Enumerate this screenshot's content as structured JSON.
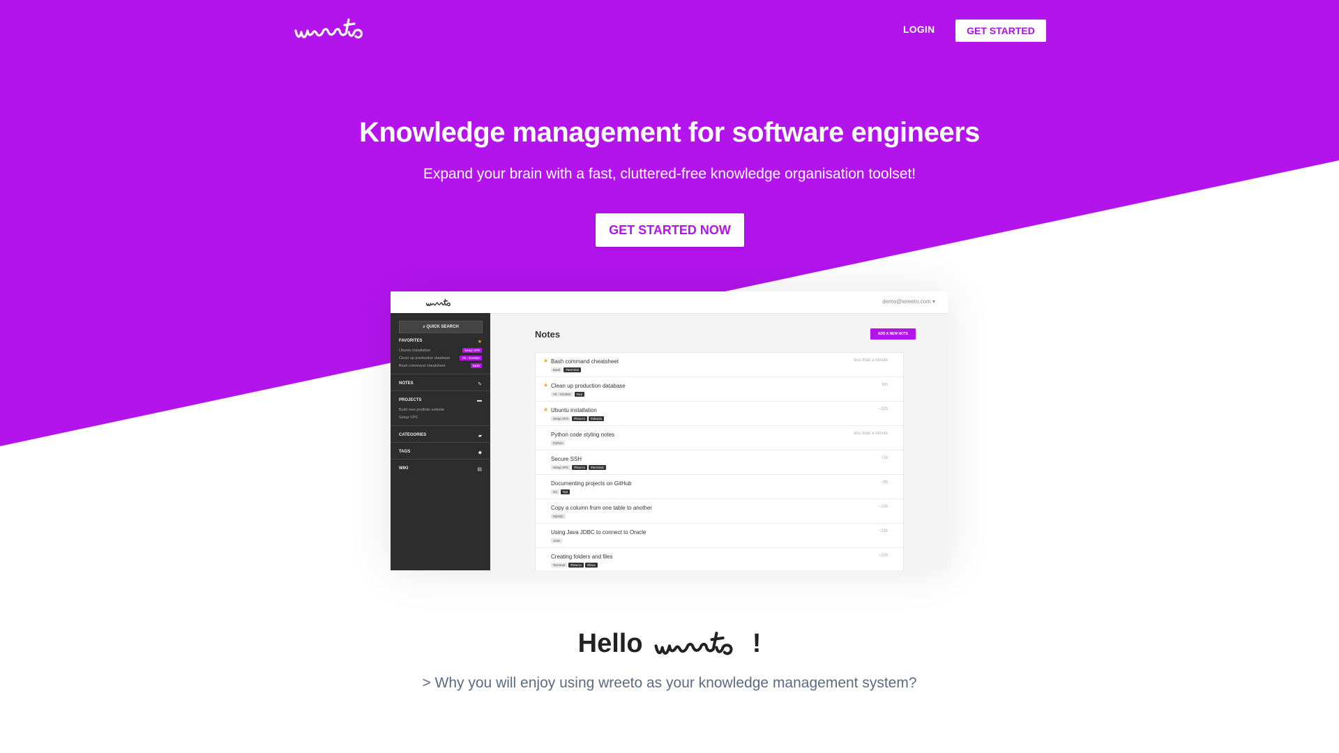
{
  "theme": {
    "accent": "#b314ec",
    "hero_bg": "#b314ec",
    "text_dark": "#222222",
    "text_muted": "#5b6b82"
  },
  "brand": {
    "name": "wreeto"
  },
  "nav": {
    "login_label": "LOGIN",
    "cta_label": "GET STARTED"
  },
  "hero": {
    "title": "Knowledge management for software engineers",
    "subtitle": "Expand your brain with a fast, cluttered-free knowledge organisation toolset!",
    "cta_label": "GET STARTED NOW"
  },
  "preview": {
    "user_menu": "demo@wreeto.com ▾",
    "sidebar": {
      "quick_search": "QUICK SEARCH",
      "favorites_label": "FAVORITES",
      "favorites": [
        {
          "label": "Ubuntu installation",
          "tag": "Setup VPS"
        },
        {
          "label": "Clean up production database",
          "tag": "Y6 - October"
        },
        {
          "label": "Bash command cheatsheet",
          "tag": "Bash"
        }
      ],
      "notes_label": "NOTES",
      "projects_label": "PROJECTS",
      "projects": [
        "Build new portfolio website",
        "Setup VPS"
      ],
      "categories_label": "CATEGORIES",
      "tags_label": "TAGS",
      "wiki_label": "WIKI"
    },
    "main": {
      "title": "Notes",
      "add_label": "ADD A NEW NOTE",
      "notes": [
        {
          "title": "Bash command cheatsheet",
          "time": "less than a minute",
          "starred": true,
          "tags": [
            {
              "t": "Bash",
              "s": "l"
            },
            {
              "t": "#terminal",
              "s": "d"
            }
          ]
        },
        {
          "title": "Clean up production database",
          "time": "6m",
          "starred": true,
          "tags": [
            {
              "t": "Y6 - October",
              "s": "l"
            },
            {
              "t": "#sql",
              "s": "d"
            }
          ]
        },
        {
          "title": "Ubuntu installation",
          "time": "~22h",
          "starred": true,
          "tags": [
            {
              "t": "Setup VPS",
              "s": "l"
            },
            {
              "t": "#how-to",
              "s": "d"
            },
            {
              "t": "#ubuntu",
              "s": "d"
            }
          ]
        },
        {
          "title": "Python code styling notes",
          "time": "less than a minute",
          "starred": false,
          "tags": [
            {
              "t": "Python",
              "s": "l"
            }
          ]
        },
        {
          "title": "Secure SSH",
          "time": "~1h",
          "starred": false,
          "tags": [
            {
              "t": "Setup VPS",
              "s": "l"
            },
            {
              "t": "#how-to",
              "s": "d"
            },
            {
              "t": "#terminal",
              "s": "d"
            }
          ]
        },
        {
          "title": "Documenting projects on GitHub",
          "time": "~8h",
          "starred": false,
          "tags": [
            {
              "t": "Git",
              "s": "l"
            },
            {
              "t": "#git",
              "s": "d"
            }
          ]
        },
        {
          "title": "Copy a column from one table to another",
          "time": "~22h",
          "starred": false,
          "tags": [
            {
              "t": "MySQL",
              "s": "l"
            }
          ]
        },
        {
          "title": "Using Java JDBC to connect to Oracle",
          "time": "~23h",
          "starred": false,
          "tags": [
            {
              "t": "Java",
              "s": "l"
            }
          ]
        },
        {
          "title": "Creating folders and files",
          "time": "~22h",
          "starred": false,
          "tags": [
            {
              "t": "Terminal",
              "s": "l"
            },
            {
              "t": "#how-to",
              "s": "d"
            },
            {
              "t": "#linux",
              "s": "d"
            }
          ]
        }
      ]
    }
  },
  "about": {
    "hello_prefix": "Hello",
    "hello_suffix": "!",
    "why": "> Why you will enjoy using wreeto as your knowledge management system?"
  }
}
